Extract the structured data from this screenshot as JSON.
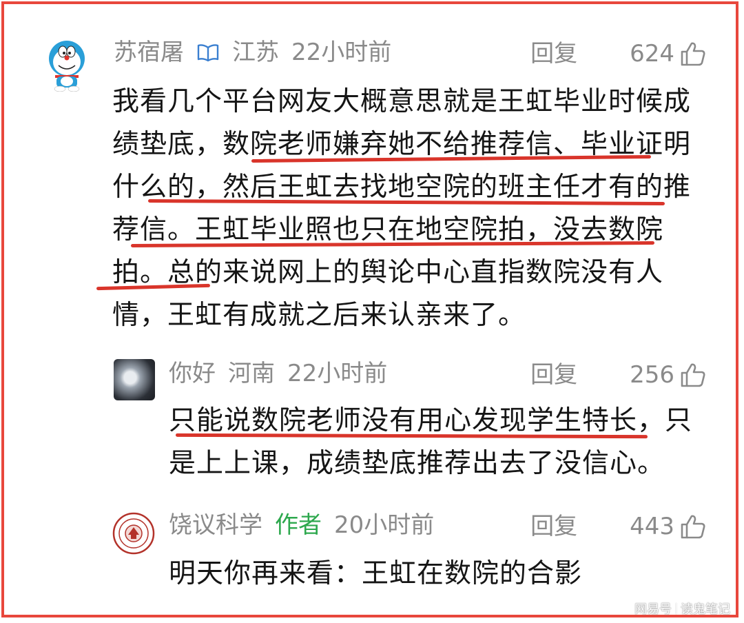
{
  "comments": [
    {
      "author": "苏宿屠",
      "location": "江苏",
      "time": "22小时前",
      "reply_label": "回复",
      "likes": "624",
      "lines": [
        "我看几个平台网友大概意思就是王虹毕业时候成",
        "绩垫底，数院老师嫌弃她不给推荐信、毕业证明",
        "什么的，然后王虹去找地空院的班主任才有的推",
        "荐信。王虹毕业照也只在地空院拍，没去数院",
        "拍。总的来说网上的舆论中心直指数院没有人",
        "情，王虹有成就之后来认亲来了。"
      ]
    },
    {
      "author": "你好",
      "location": "河南",
      "time": "22小时前",
      "reply_label": "回复",
      "likes": "256",
      "lines": [
        "只能说数院老师没有用心发现学生特长，只",
        "是上上课，成绩垫底推荐出去了没信心。"
      ]
    },
    {
      "author": "饶议科学",
      "badge": "作者",
      "time": "20小时前",
      "reply_label": "回复",
      "likes": "443",
      "lines": [
        "明天你再来看：王虹在数院的合影"
      ]
    }
  ],
  "watermark": {
    "left": "网易号",
    "right": "读鬼笔记"
  },
  "colors": {
    "frame": "#e8473c",
    "underline": "#d9352b",
    "meta_text": "#8a8a8a",
    "author_badge": "#2da84d",
    "verified_icon": "#3a7fd0"
  },
  "icons": [
    "doraemon-avatar",
    "verified-book-icon",
    "thumbs-up-icon",
    "university-seal-avatar"
  ]
}
